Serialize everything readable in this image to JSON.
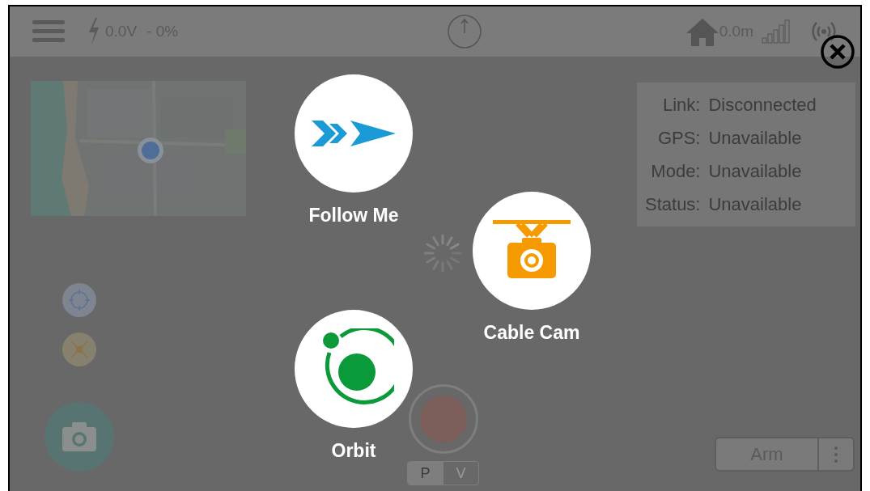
{
  "top_bar": {
    "battery_voltage": "0.0V",
    "battery_percent": "- 0%",
    "home_distance": "0.0m"
  },
  "status_panel": [
    {
      "label": "Link:",
      "value": "Disconnected"
    },
    {
      "label": "GPS:",
      "value": "Unavailable"
    },
    {
      "label": "Mode:",
      "value": "Unavailable"
    },
    {
      "label": "Status:",
      "value": "Unavailable"
    }
  ],
  "modes": [
    {
      "kind": "follow",
      "label": "Follow Me"
    },
    {
      "kind": "cable",
      "label": "Cable Cam"
    },
    {
      "kind": "orbit",
      "label": "Orbit"
    }
  ],
  "record_mode_toggle": [
    {
      "label": "P",
      "selected": true
    },
    {
      "label": "V",
      "selected": false
    }
  ],
  "arm_button": {
    "label": "Arm"
  }
}
